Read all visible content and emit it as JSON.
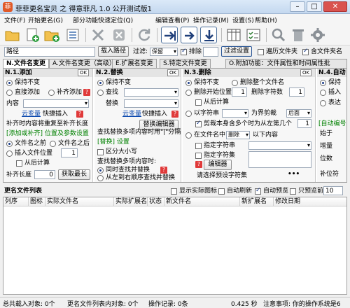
{
  "window": {
    "title": "菲菲更名宝贝 之 得意菲凡 1.0 公开测试版1",
    "min": "–",
    "max": "□",
    "close": "✕"
  },
  "menu": [
    "文件(F)",
    "开始更名(G)",
    "部分功能快速定位(Q)",
    "编辑查看(P)",
    "操作记录(M)",
    "设置(S)",
    "帮助(H)"
  ],
  "toolbar_icons": [
    "open-folder-icon",
    "add-file-icon",
    "add-folder-icon",
    "list-icon",
    "delete-icon",
    "clear-icon",
    "refresh-icon",
    "arrow-right-icon",
    "arrow-right-icon",
    "arrow-down-icon",
    "columns-icon",
    "checklist-icon",
    "search-icon",
    "trash-icon",
    "settings-icon"
  ],
  "pathbar": {
    "label": "路径",
    "load_btn": "载入路径",
    "filter_label": "过滤:",
    "filter_keep": "保留",
    "filter_exclude": "排除",
    "filter_btn": "过滤设置",
    "traverse": "遍历文件夹",
    "include_ext": "含文件夹名"
  },
  "tabs": [
    "N.文件名变更",
    "A.文件名变更（高级）",
    "E.扩展名变更",
    "S.特定文件变更",
    "O.附加功能：文件属性和时间属性批"
  ],
  "p1": {
    "title": "N.1.添加",
    "ok": "OK",
    "keep": "保持不变",
    "direct_add": "直接添加",
    "pad_add": "补齐添加",
    "content_label": "内容",
    "var_link": "云变量",
    "quick_insert": "快捷插入",
    "pad_hint": "补齐时内容将重复至补齐长度",
    "section": "[添加或补齐] 位置及参数设置",
    "before_name": "文件名之前",
    "after_name": "文件名之后",
    "insert_pos": "插入文件位置",
    "pos_value": "1",
    "from_back": "从后计算",
    "pad_len_label": "补齐长度",
    "pad_len_value": "0",
    "get_len_btn": "获取最长"
  },
  "p2": {
    "title": "N.2.替换",
    "ok": "OK",
    "keep": "保持不变",
    "find": "查找",
    "replace": "替换",
    "var_link": "云变量",
    "quick_insert": "快捷插入",
    "split_hint": "查找替换多项内容时用\"|\"分隔",
    "editor_btn": "替换编辑器",
    "section": "[替换] 设置",
    "case": "区分大小写",
    "multi_hint": "查找替换多项内容时:",
    "sync_replace": "同时查找并替换",
    "order_replace": "从左到右顺序查找并替换"
  },
  "p3": {
    "title": "N.3.删除",
    "ok": "OK",
    "keep": "保持不变",
    "delete_whole": "删除整个文件名",
    "delete_start": "删除开始位置",
    "start_value": "1",
    "delete_count": "删除字符数",
    "count_value": "1",
    "from_back": "从后计算",
    "by_char": "以字符串",
    "cut_as": "为界剪裁",
    "after_opt": "后面",
    "cut_self": "剪裁本身",
    "contain_char": "含多个时为从左第几个",
    "nth_value": "1",
    "in_name": "在文件名中",
    "del_opt": "删除",
    "below": "以下内容",
    "specify_string": "指定字符串",
    "specify_set": "指定字符集",
    "editor_btn": "编辑器",
    "preset_label": "请选择预设字符集"
  },
  "p4": {
    "title": "N.4.自动",
    "keep": "保持",
    "insert": "插入",
    "expr": "表达",
    "section": "[自动编号]",
    "start": "始于",
    "step": "增量",
    "digits": "位数",
    "pad": "补位符"
  },
  "list": {
    "label": "更名文件列表",
    "show_icon": "显示实际图标",
    "auto_refresh": "自动刷新",
    "auto_preview": "自动预览",
    "preview_only": "只预览前",
    "preview_n": "10",
    "columns": [
      "列序",
      "图标",
      "实际文件名",
      "实际扩展名",
      "状态",
      "新文件名",
      "新扩展名",
      "修改日期"
    ]
  },
  "status": {
    "loaded": "总共载入对象: 0个",
    "list_count": "更名文件列表内对象: 0个",
    "ops": "操作记录: 0条",
    "time": "0.425 秒",
    "tip": "注意事项: 你的操作系统是6"
  }
}
